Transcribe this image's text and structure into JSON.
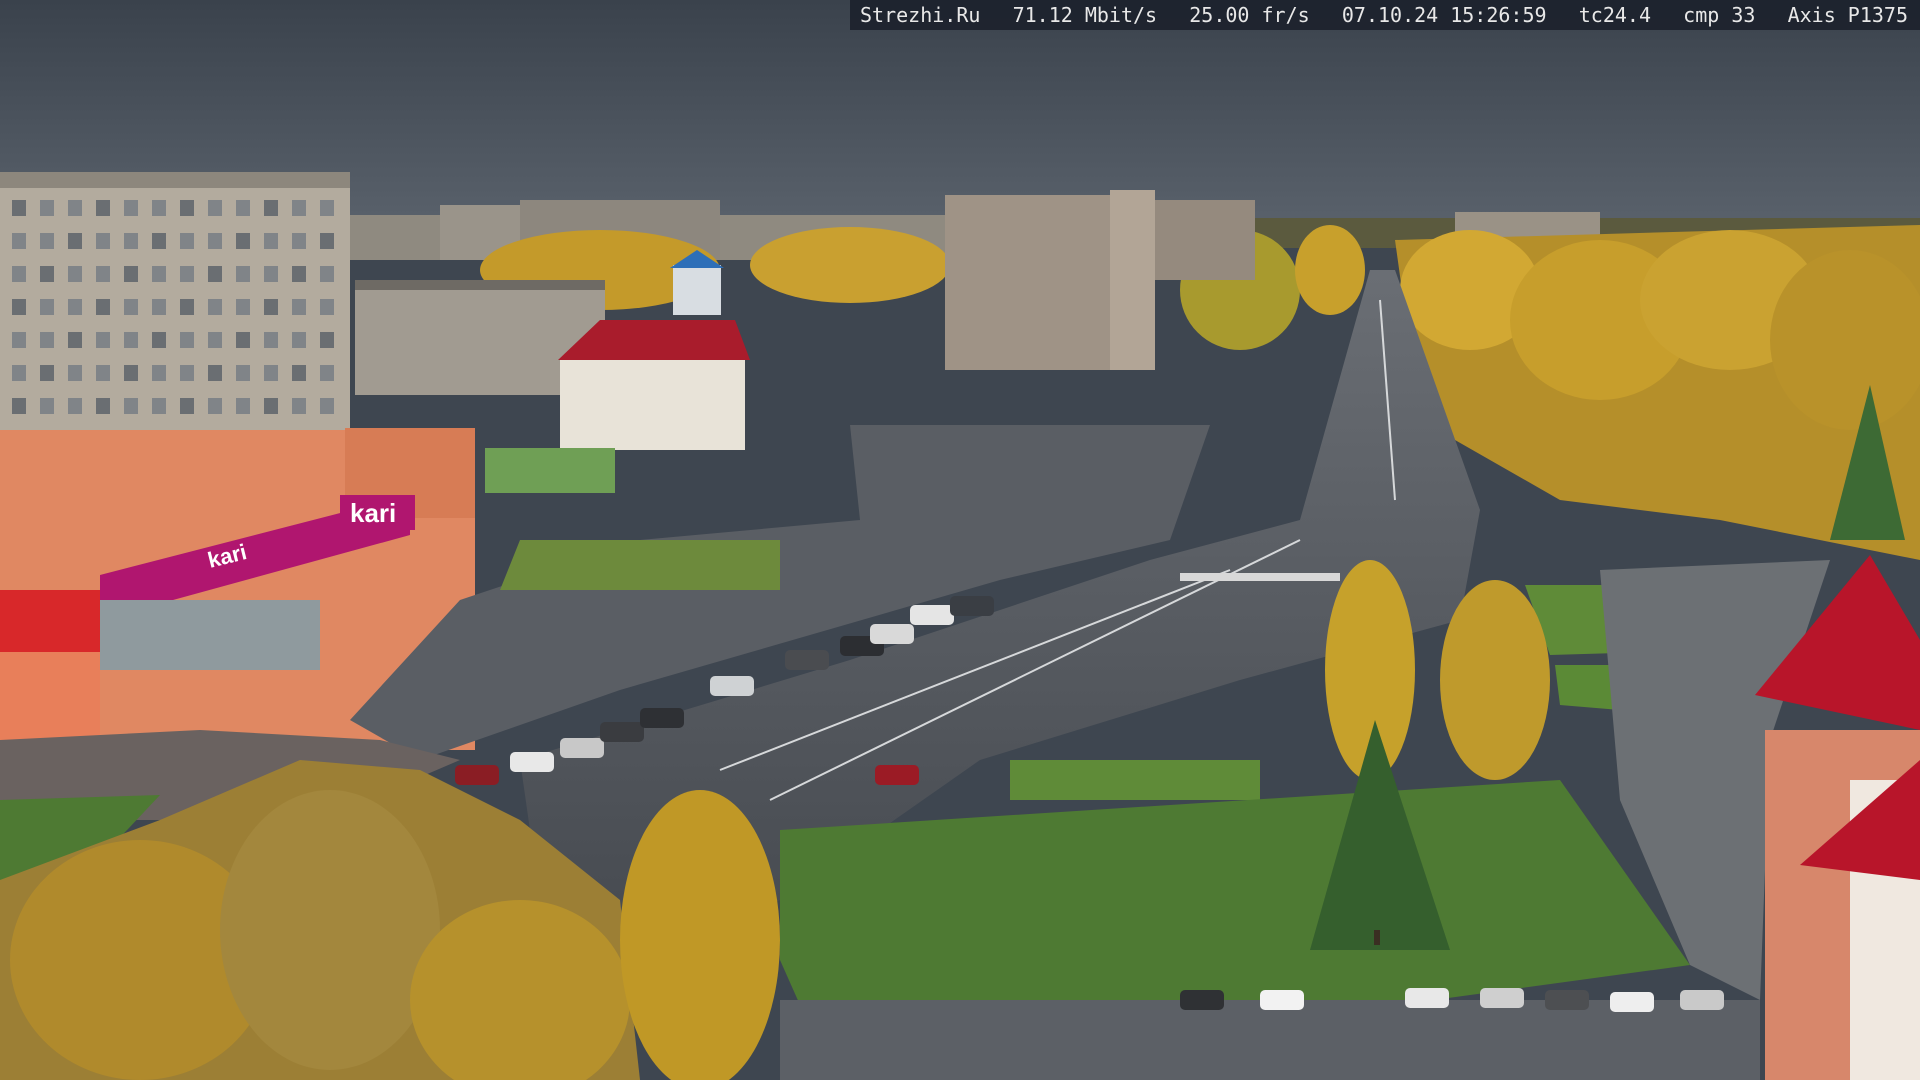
{
  "overlay": {
    "site": "Strezhi.Ru",
    "bitrate": "71.12 Mbit/s",
    "fps": "25.00 fr/s",
    "datetime": "07.10.24 15:26:59",
    "tc": "tc24.4",
    "cmp": "cmp 33",
    "camera": "Axis P1375"
  },
  "signage": {
    "store_logo": "kari",
    "store_banner": "kari"
  },
  "colors": {
    "sky": "#4a525c",
    "foliage": "#c9a030",
    "asphalt": "#4c5058",
    "grass": "#4e7a33",
    "store_brand": "#b0166f",
    "roof_red": "#b31c2c"
  }
}
